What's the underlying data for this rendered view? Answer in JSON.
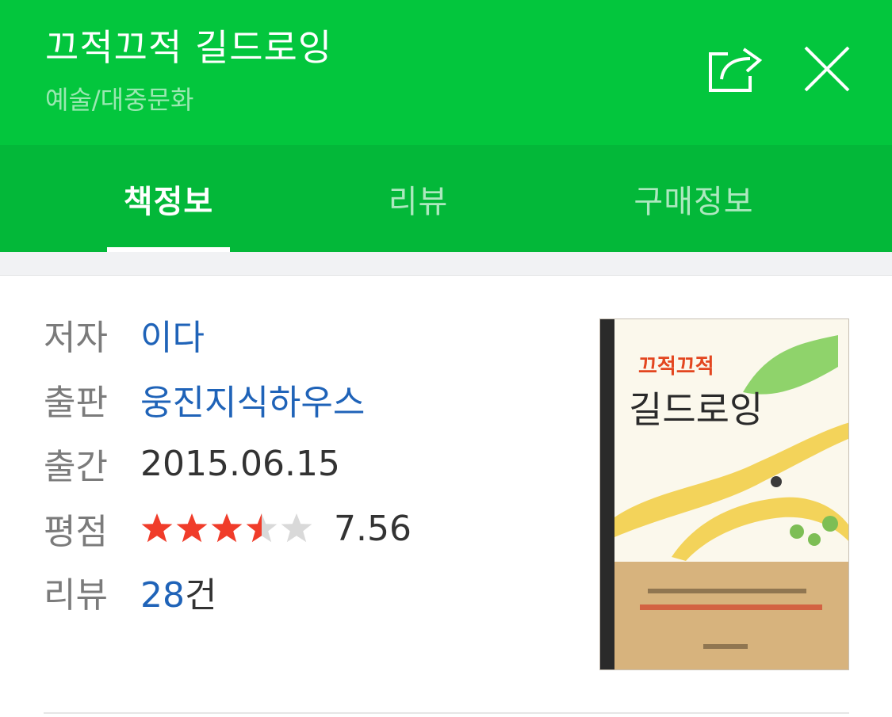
{
  "header": {
    "title": "끄적끄적 길드로잉",
    "category": "예술/대중문화",
    "share_icon": "share-icon",
    "close_icon": "close-icon",
    "background_color": "#03c63d"
  },
  "tabs": [
    {
      "label": "책정보",
      "active": true
    },
    {
      "label": "리뷰",
      "active": false
    },
    {
      "label": "구매정보",
      "active": false
    }
  ],
  "book": {
    "author_label": "저자",
    "author": "이다",
    "publisher_label": "출판",
    "publisher": "웅진지식하우스",
    "published_label": "출간",
    "published": "2015.06.15",
    "rating_label": "평점",
    "rating_score": "7.56",
    "rating_stars": 3.5,
    "rating_stars_max": 5,
    "review_label": "리뷰",
    "review_count": "28",
    "review_unit": "건",
    "link_color": "#1f63b8",
    "star_color": "#f03c2a"
  },
  "cover": {
    "title_small": "끄적끄적",
    "title_large": "길드로잉"
  }
}
